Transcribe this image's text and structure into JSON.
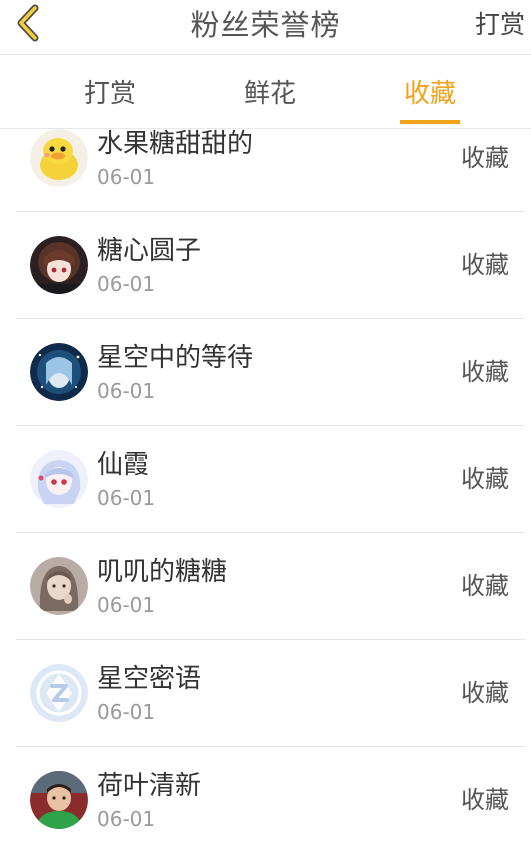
{
  "header": {
    "title": "粉丝荣誉榜",
    "action_label": "打赏"
  },
  "tabs": [
    {
      "label": "打赏",
      "active": false
    },
    {
      "label": "鲜花",
      "active": false
    },
    {
      "label": "收藏",
      "active": true
    }
  ],
  "list": [
    {
      "name": "水果糖甜甜的",
      "date": "06-01",
      "action": "收藏",
      "avatar_icon": "duck-avatar-icon"
    },
    {
      "name": "糖心圆子",
      "date": "06-01",
      "action": "收藏",
      "avatar_icon": "anime-girl-avatar-icon"
    },
    {
      "name": "星空中的等待",
      "date": "06-01",
      "action": "收藏",
      "avatar_icon": "starry-avatar-icon"
    },
    {
      "name": "仙霞",
      "date": "06-01",
      "action": "收藏",
      "avatar_icon": "anime-girl-avatar-icon"
    },
    {
      "name": "叽叽的糖糖",
      "date": "06-01",
      "action": "收藏",
      "avatar_icon": "portrait-avatar-icon"
    },
    {
      "name": "星空密语",
      "date": "06-01",
      "action": "收藏",
      "avatar_icon": "default-avatar-icon"
    },
    {
      "name": "荷叶清新",
      "date": "06-01",
      "action": "收藏",
      "avatar_icon": "photo-avatar-icon"
    }
  ],
  "colors": {
    "accent": "#f0a21b",
    "text": "#333333",
    "secondary_text": "#9a9a9a",
    "divider": "#e6e6e6"
  }
}
